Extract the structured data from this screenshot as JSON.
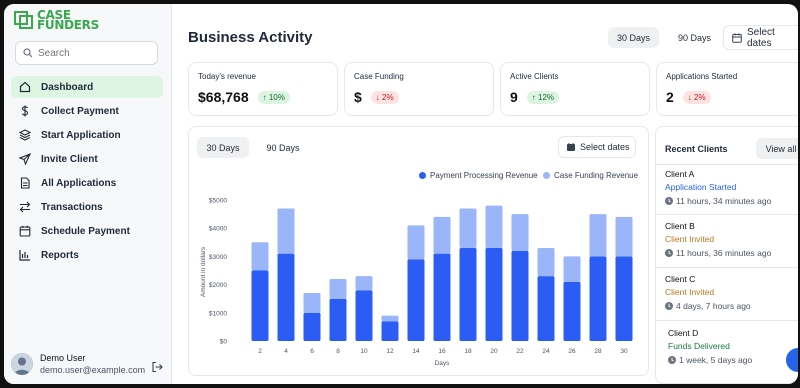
{
  "brand": {
    "line1": "CASE",
    "line2": "FUNDERS",
    "color": "#3aa84e"
  },
  "search": {
    "placeholder": "Search"
  },
  "nav": [
    {
      "label": "Dashboard",
      "icon": "home-icon",
      "active": true
    },
    {
      "label": "Collect Payment",
      "icon": "dollar-icon"
    },
    {
      "label": "Start Application",
      "icon": "layers-icon"
    },
    {
      "label": "Invite Client",
      "icon": "send-icon"
    },
    {
      "label": "All Applications",
      "icon": "file-icon"
    },
    {
      "label": "Transactions",
      "icon": "transfer-icon"
    },
    {
      "label": "Schedule Payment",
      "icon": "calendar-icon"
    },
    {
      "label": "Reports",
      "icon": "bar-chart-icon"
    }
  ],
  "user": {
    "name": "Demo User",
    "email": "demo.user@example.com"
  },
  "header": {
    "title": "Business Activity",
    "range_30": "30 Days",
    "range_90": "90 Days",
    "select_dates": "Select dates"
  },
  "stats": [
    {
      "label": "Today's revenue",
      "value": "$68,768",
      "change": "↑ 10%",
      "trend": "up"
    },
    {
      "label": "Case Funding",
      "value": "$",
      "change": "↓ 2%",
      "trend": "down"
    },
    {
      "label": "Active Clients",
      "value": "9",
      "change": "↑ 12%",
      "trend": "up"
    },
    {
      "label": "Applications Started",
      "value": "2",
      "change": "↓ 2%",
      "trend": "down"
    }
  ],
  "chart_card": {
    "tab_30": "30 Days",
    "tab_90": "90 Days",
    "select_dates": "Select dates"
  },
  "chart_data": {
    "type": "bar",
    "stacked": true,
    "categories": [
      "2",
      "4",
      "6",
      "8",
      "10",
      "12",
      "14",
      "16",
      "18",
      "20",
      "22",
      "24",
      "26",
      "28",
      "30"
    ],
    "series": [
      {
        "name": "Payment Processing Revenue",
        "color": "#2b5cf3",
        "values": [
          2500,
          3100,
          1000,
          1500,
          1800,
          700,
          2900,
          3100,
          3300,
          3300,
          3200,
          2300,
          2100,
          3000,
          3000
        ]
      },
      {
        "name": "Case Funding Revenue",
        "color": "#9ab6f9",
        "values": [
          1000,
          1600,
          700,
          700,
          500,
          200,
          1200,
          1300,
          1400,
          1500,
          1300,
          1000,
          900,
          1500,
          1400
        ]
      }
    ],
    "xlabel": "Days",
    "ylabel": "Amount in dollars",
    "yticks": [
      "$0",
      "$1000",
      "$2000",
      "$3000",
      "$4000",
      "$5000"
    ],
    "ylim": [
      0,
      5000
    ],
    "legend": "top-right",
    "grid": false
  },
  "recent": {
    "title": "Recent Clients",
    "view_all": "View all",
    "clients": [
      {
        "name": "Client A",
        "status": "Application Started",
        "status_color": "#2563eb",
        "time": "11 hours, 34 minutes ago"
      },
      {
        "name": "Client B",
        "status": "Client Invited",
        "status_color": "#b7791f",
        "time": "11 hours, 36 minutes ago"
      },
      {
        "name": "Client C",
        "status": "Client Invited",
        "status_color": "#b7791f",
        "time": "4 days, 7 hours ago"
      },
      {
        "name": "Client D",
        "status": "Funds Delivered",
        "status_color": "#15803d",
        "time": "1 week, 5 days ago"
      }
    ]
  }
}
